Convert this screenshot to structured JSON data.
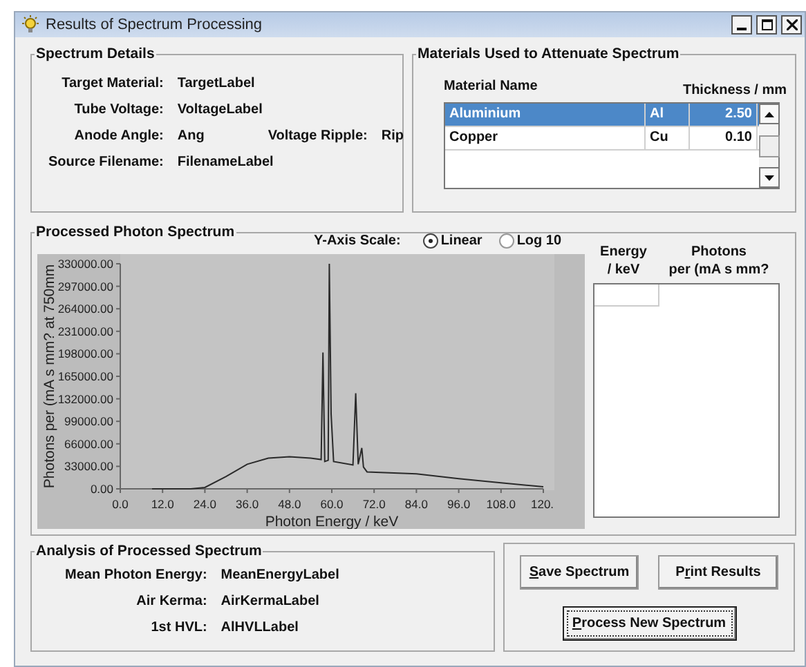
{
  "window": {
    "title": "Results of Spectrum Processing"
  },
  "spectrum_details": {
    "title": "Spectrum Details",
    "rows": [
      {
        "label": "Target Material:",
        "value": "TargetLabel"
      },
      {
        "label": "Tube Voltage:",
        "value": "VoltageLabel"
      },
      {
        "label": "Anode Angle:",
        "value": "Ang",
        "extra_label": "Voltage Ripple:",
        "extra_value": "Rip"
      },
      {
        "label": "Source Filename:",
        "value": "FilenameLabel"
      }
    ]
  },
  "materials": {
    "title": "Materials Used to Attenuate Spectrum",
    "columns": [
      "Material Name",
      "Thickness / mm"
    ],
    "rows": [
      {
        "name": "Aluminium",
        "symbol": "Al",
        "thickness": "2.50",
        "selected": true
      },
      {
        "name": "Copper",
        "symbol": "Cu",
        "thickness": "0.10",
        "selected": false
      }
    ]
  },
  "processed": {
    "title": "Processed Photon Spectrum",
    "scale_label": "Y-Axis Scale:",
    "scale_options": [
      {
        "label": "Linear",
        "selected": true
      },
      {
        "label": "Log 10",
        "selected": false
      }
    ],
    "chart_data": {
      "type": "line",
      "xlabel": "Photon Energy / keV",
      "ylabel": "Photons per (mA s mm? at 750mm",
      "x": [
        9,
        12,
        20,
        24,
        30,
        36,
        42,
        48,
        54,
        57,
        57.5,
        58,
        59,
        59.3,
        59.8,
        60.5,
        66,
        66.8,
        67.5,
        68.5,
        69,
        70,
        84,
        96,
        108,
        120
      ],
      "series": [
        {
          "color": "#2a2a2a",
          "values": [
            0,
            0,
            0,
            2000,
            18000,
            36000,
            45000,
            47000,
            45000,
            43000,
            200000,
            40000,
            42000,
            330000,
            110000,
            40000,
            35000,
            140000,
            36000,
            60000,
            32000,
            25000,
            22000,
            15000,
            9000,
            3000
          ]
        }
      ],
      "xlim": [
        0,
        120
      ],
      "ylim": [
        0,
        330000
      ],
      "xticks": [
        {
          "value": 0,
          "label": "0.0"
        },
        {
          "value": 12,
          "label": "12.0"
        },
        {
          "value": 24,
          "label": "24.0"
        },
        {
          "value": 36,
          "label": "36.0"
        },
        {
          "value": 48,
          "label": "48.0"
        },
        {
          "value": 60,
          "label": "60.0"
        },
        {
          "value": 72,
          "label": "72.0"
        },
        {
          "value": 84,
          "label": "84.0"
        },
        {
          "value": 96,
          "label": "96.0"
        },
        {
          "value": 108,
          "label": "108.0"
        },
        {
          "value": 120,
          "label": "120."
        }
      ],
      "yticks": [
        {
          "value": 0,
          "label": "0.00"
        },
        {
          "value": 33000,
          "label": "33000.00"
        },
        {
          "value": 66000,
          "label": "66000.00"
        },
        {
          "value": 99000,
          "label": "99000.00"
        },
        {
          "value": 132000,
          "label": "132000.00"
        },
        {
          "value": 165000,
          "label": "165000.00"
        },
        {
          "value": 198000,
          "label": "198000.00"
        },
        {
          "value": 231000,
          "label": "231000.00"
        },
        {
          "value": 264000,
          "label": "264000.00"
        },
        {
          "value": 297000,
          "label": "297000.00"
        },
        {
          "value": 330000,
          "label": "330000.00"
        }
      ]
    },
    "table_columns": [
      {
        "line1": "Energy",
        "line2": "/ keV"
      },
      {
        "line1": "Photons",
        "line2": "per (mA s mm?"
      }
    ]
  },
  "analysis": {
    "title": "Analysis of Processed Spectrum",
    "rows": [
      {
        "label": "Mean Photon Energy:",
        "value": "MeanEnergyLabel"
      },
      {
        "label": "Air Kerma:",
        "value": "AirKermaLabel"
      },
      {
        "label": "1st HVL:",
        "value": "AlHVLLabel"
      }
    ]
  },
  "buttons": [
    {
      "key": "S",
      "rest": "ave Spectrum",
      "focused": false
    },
    {
      "before": "P",
      "key": "r",
      "rest": "int Results",
      "focused": false
    },
    {
      "key": "P",
      "rest": "rocess New Spectrum",
      "focused": true
    }
  ]
}
